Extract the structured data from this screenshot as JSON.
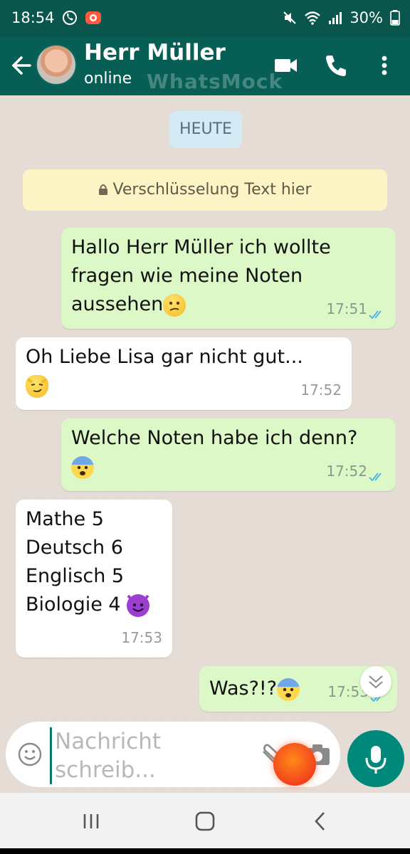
{
  "status_bar": {
    "time": "18:54",
    "battery": "30%"
  },
  "header": {
    "contact_name": "Herr Müller",
    "status": "online",
    "watermark": "WhatsMock"
  },
  "chat": {
    "day_label": "HEUTE",
    "encryption_notice": "Verschlüsselung Text hier",
    "messages": [
      {
        "direction": "out",
        "lines": [
          "Hallo Herr Müller ich wollte",
          "fragen wie meine Noten",
          "aussehen"
        ],
        "time": "17:51"
      },
      {
        "direction": "in",
        "lines": [
          "Oh Liebe Lisa gar nicht gut..."
        ],
        "time": "17:52"
      },
      {
        "direction": "out",
        "lines": [
          "Welche Noten habe ich denn?"
        ],
        "time": "17:52"
      },
      {
        "direction": "in",
        "lines": [
          "Mathe 5",
          "Deutsch 6",
          "Englisch 5",
          "Biologie 4"
        ],
        "time": "17:53"
      },
      {
        "direction": "out",
        "lines": [
          "Was?!?"
        ],
        "time": "17:53"
      }
    ]
  },
  "composer": {
    "placeholder": "Nachricht schreib..."
  },
  "colors": {
    "header": "#075e54",
    "status_bar": "#0a564c",
    "outgoing_bubble": "#dcf8c6",
    "incoming_bubble": "#ffffff",
    "mic_button": "#00897b"
  },
  "icons": [
    "back-arrow-icon",
    "video-call-icon",
    "phone-icon",
    "more-vert-icon",
    "lock-icon",
    "double-check-icon",
    "emoji-icon",
    "attach-icon",
    "camera-icon",
    "mic-icon",
    "chevron-down-icon"
  ]
}
